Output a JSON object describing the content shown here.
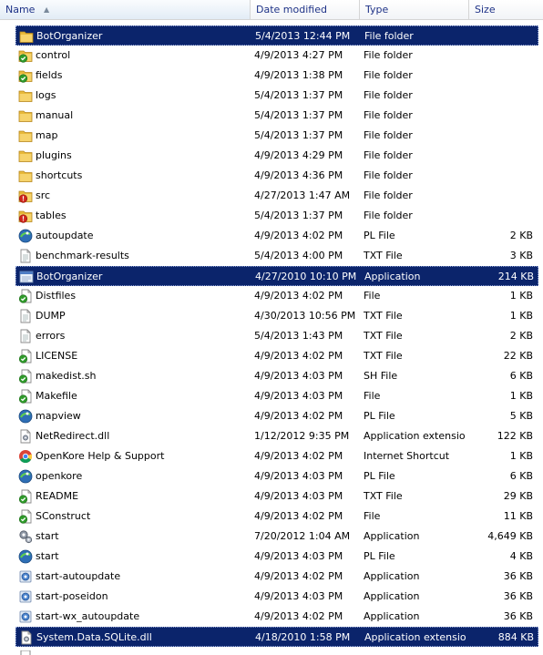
{
  "columns": {
    "name": "Name",
    "date": "Date modified",
    "type": "Type",
    "size": "Size"
  },
  "files": [
    {
      "name": "BotOrganizer",
      "date": "5/4/2013 12:44 PM",
      "type": "File folder",
      "size": "",
      "icon": "folder-icon",
      "selected": true
    },
    {
      "name": "control",
      "date": "4/9/2013 4:27 PM",
      "type": "File folder",
      "size": "",
      "icon": "folder-check-icon",
      "selected": false
    },
    {
      "name": "fields",
      "date": "4/9/2013 1:38 PM",
      "type": "File folder",
      "size": "",
      "icon": "folder-check-icon",
      "selected": false
    },
    {
      "name": "logs",
      "date": "5/4/2013 1:37 PM",
      "type": "File folder",
      "size": "",
      "icon": "folder-icon",
      "selected": false
    },
    {
      "name": "manual",
      "date": "5/4/2013 1:37 PM",
      "type": "File folder",
      "size": "",
      "icon": "folder-icon",
      "selected": false
    },
    {
      "name": "map",
      "date": "5/4/2013 1:37 PM",
      "type": "File folder",
      "size": "",
      "icon": "folder-icon",
      "selected": false
    },
    {
      "name": "plugins",
      "date": "4/9/2013 4:29 PM",
      "type": "File folder",
      "size": "",
      "icon": "folder-icon",
      "selected": false
    },
    {
      "name": "shortcuts",
      "date": "4/9/2013 4:36 PM",
      "type": "File folder",
      "size": "",
      "icon": "folder-icon",
      "selected": false
    },
    {
      "name": "src",
      "date": "4/27/2013 1:47 AM",
      "type": "File folder",
      "size": "",
      "icon": "folder-alert-icon",
      "selected": false
    },
    {
      "name": "tables",
      "date": "5/4/2013 1:37 PM",
      "type": "File folder",
      "size": "",
      "icon": "folder-alert-icon",
      "selected": false
    },
    {
      "name": "autoupdate",
      "date": "4/9/2013 4:02 PM",
      "type": "PL File",
      "size": "2 KB",
      "icon": "perl-script-icon",
      "selected": false
    },
    {
      "name": "benchmark-results",
      "date": "5/4/2013 4:00 PM",
      "type": "TXT File",
      "size": "3 KB",
      "icon": "text-file-icon",
      "selected": false
    },
    {
      "name": "BotOrganizer",
      "date": "4/27/2010 10:10 PM",
      "type": "Application",
      "size": "214 KB",
      "icon": "application-window-icon",
      "selected": true
    },
    {
      "name": "Distfiles",
      "date": "4/9/2013 4:02 PM",
      "type": "File",
      "size": "1 KB",
      "icon": "file-check-icon",
      "selected": false
    },
    {
      "name": "DUMP",
      "date": "4/30/2013 10:56 PM",
      "type": "TXT File",
      "size": "1 KB",
      "icon": "text-file-icon",
      "selected": false
    },
    {
      "name": "errors",
      "date": "5/4/2013 1:43 PM",
      "type": "TXT File",
      "size": "2 KB",
      "icon": "text-file-icon",
      "selected": false
    },
    {
      "name": "LICENSE",
      "date": "4/9/2013 4:02 PM",
      "type": "TXT File",
      "size": "22 KB",
      "icon": "file-check-icon",
      "selected": false
    },
    {
      "name": "makedist.sh",
      "date": "4/9/2013 4:03 PM",
      "type": "SH File",
      "size": "6 KB",
      "icon": "file-check-icon",
      "selected": false
    },
    {
      "name": "Makefile",
      "date": "4/9/2013 4:03 PM",
      "type": "File",
      "size": "1 KB",
      "icon": "file-check-icon",
      "selected": false
    },
    {
      "name": "mapview",
      "date": "4/9/2013 4:02 PM",
      "type": "PL File",
      "size": "5 KB",
      "icon": "perl-script-icon",
      "selected": false
    },
    {
      "name": "NetRedirect.dll",
      "date": "1/12/2012 9:35 PM",
      "type": "Application extension",
      "size": "122 KB",
      "icon": "dll-file-icon",
      "selected": false
    },
    {
      "name": "OpenKore Help & Support",
      "date": "4/9/2013 4:02 PM",
      "type": "Internet Shortcut",
      "size": "1 KB",
      "icon": "chrome-shortcut-icon",
      "selected": false
    },
    {
      "name": "openkore",
      "date": "4/9/2013 4:03 PM",
      "type": "PL File",
      "size": "6 KB",
      "icon": "perl-script-icon",
      "selected": false
    },
    {
      "name": "README",
      "date": "4/9/2013 4:03 PM",
      "type": "TXT File",
      "size": "29 KB",
      "icon": "file-check-icon",
      "selected": false
    },
    {
      "name": "SConstruct",
      "date": "4/9/2013 4:02 PM",
      "type": "File",
      "size": "11 KB",
      "icon": "file-check-icon",
      "selected": false
    },
    {
      "name": "start",
      "date": "7/20/2012 1:04 AM",
      "type": "Application",
      "size": "4,649 KB",
      "icon": "gears-icon",
      "selected": false
    },
    {
      "name": "start",
      "date": "4/9/2013 4:03 PM",
      "type": "PL File",
      "size": "4 KB",
      "icon": "perl-script-icon",
      "selected": false
    },
    {
      "name": "start-autoupdate",
      "date": "4/9/2013 4:02 PM",
      "type": "Application",
      "size": "36 KB",
      "icon": "batch-gear-icon",
      "selected": false
    },
    {
      "name": "start-poseidon",
      "date": "4/9/2013 4:03 PM",
      "type": "Application",
      "size": "36 KB",
      "icon": "batch-gear-icon",
      "selected": false
    },
    {
      "name": "start-wx_autoupdate",
      "date": "4/9/2013 4:02 PM",
      "type": "Application",
      "size": "36 KB",
      "icon": "batch-gear-icon",
      "selected": false
    },
    {
      "name": "System.Data.SQLite.dll",
      "date": "4/18/2010 1:58 PM",
      "type": "Application extension",
      "size": "884 KB",
      "icon": "dll-file-icon",
      "selected": true
    }
  ]
}
